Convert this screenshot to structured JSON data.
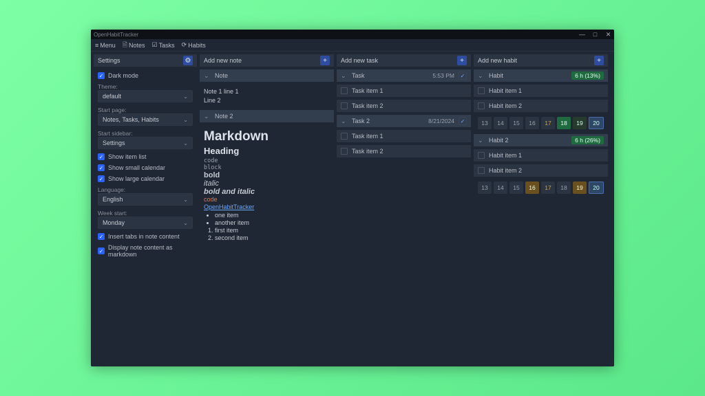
{
  "titlebar": {
    "title": "OpenHabitTracker"
  },
  "menu": {
    "menu": "Menu",
    "notes": "Notes",
    "tasks": "Tasks",
    "habits": "Habits"
  },
  "settings": {
    "header": "Settings",
    "dark_mode": "Dark mode",
    "theme_lbl": "Theme:",
    "theme_val": "default",
    "start_lbl": "Start page:",
    "start_val": "Notes, Tasks, Habits",
    "sidebar_lbl": "Start sidebar:",
    "sidebar_val": "Settings",
    "show_item_list": "Show item list",
    "show_small_cal": "Show small calendar",
    "show_large_cal": "Show large calendar",
    "lang_lbl": "Language:",
    "lang_val": "English",
    "week_lbl": "Week start:",
    "week_val": "Monday",
    "insert_tabs": "Insert tabs in note content",
    "display_md": "Display note content as markdown"
  },
  "notes": {
    "header": "Add new note",
    "note1": "Note",
    "note1_line1": "Note 1 line 1",
    "note1_line2": "Line 2",
    "note2": "Note 2",
    "md_h1": "Markdown",
    "md_h2": "Heading",
    "md_code1": "code",
    "md_code2": "block",
    "md_bold": "bold",
    "md_italic": "italic",
    "md_bi": "bold and italic",
    "md_code3": "code",
    "md_link": "OpenHabitTracker",
    "md_ul1": "one item",
    "md_ul2": "another item",
    "md_ol1": "first item",
    "md_ol2": "second item"
  },
  "tasks": {
    "header": "Add new task",
    "task1": "Task",
    "task1_time": "5:53 PM",
    "t1_i1": "Task item 1",
    "t1_i2": "Task item 2",
    "task2": "Task 2",
    "task2_date": "8/21/2024",
    "t2_i1": "Task item 1",
    "t2_i2": "Task item 2"
  },
  "habits": {
    "header": "Add new habit",
    "h1": "Habit",
    "h1_badge": "6 h (13%)",
    "h1_i1": "Habit item 1",
    "h1_i2": "Habit item 2",
    "days1": [
      "13",
      "14",
      "15",
      "16",
      "17",
      "18",
      "19",
      "20"
    ],
    "h2": "Habit 2",
    "h2_badge": "6 h (26%)",
    "h2_i1": "Habit item 1",
    "h2_i2": "Habit item 2",
    "days2": [
      "13",
      "14",
      "15",
      "16",
      "17",
      "18",
      "19",
      "20"
    ]
  }
}
